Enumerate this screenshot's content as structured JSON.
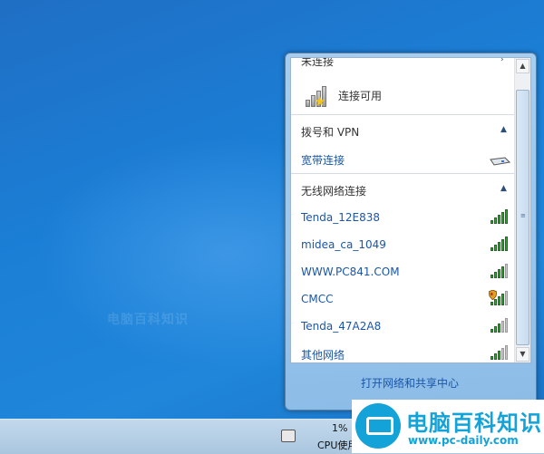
{
  "popup": {
    "cut_top_label": "未连接",
    "status_text": "连接可用",
    "sections": [
      {
        "title": "拨号和 VPN",
        "items": [
          {
            "name": "宽带连接"
          }
        ]
      },
      {
        "title": "无线网络连接",
        "items": [
          {
            "name": "Tenda_12E838",
            "signal": 5
          },
          {
            "name": "midea_ca_1049",
            "signal": 5
          },
          {
            "name": "WWW.PC841.COM",
            "signal": 4
          },
          {
            "name": "CMCC",
            "signal": 4,
            "shield": true
          },
          {
            "name": "Tenda_47A2A8",
            "signal": 3
          },
          {
            "name": "其他网络",
            "signal": 3
          }
        ]
      }
    ],
    "footer_link": "打开网络和共享中心"
  },
  "taskbar": {
    "cpu_percent": "1%",
    "cpu_label": "CPU使用"
  },
  "watermark": {
    "faint_text": "电脑百科知识",
    "logo_title": "电脑百科知识",
    "logo_url": "www.pc-daily.com"
  },
  "colors": {
    "link": "#1a56a8",
    "logo": "#13a3d9"
  }
}
